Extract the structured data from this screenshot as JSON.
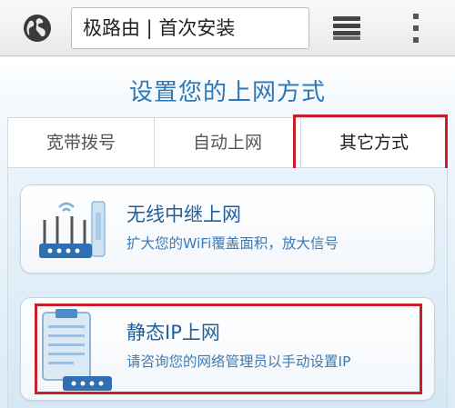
{
  "browser": {
    "address": "极路由 | 首次安装",
    "icons": {
      "globe": "globe-icon",
      "tabs": "tabs-icon",
      "menu": "more-vertical-icon"
    }
  },
  "page": {
    "title": "设置您的上网方式",
    "tabs": [
      {
        "label": "宽带拨号"
      },
      {
        "label": "自动上网"
      },
      {
        "label": "其它方式",
        "selected": true
      }
    ],
    "options": [
      {
        "title": "无线中继上网",
        "desc": "扩大您的WiFi覆盖面积，放大信号",
        "icon": "wireless-repeater-icon"
      },
      {
        "title": "静态IP上网",
        "desc": "请咨询您的网络管理员以手动设置IP",
        "icon": "static-ip-router-icon",
        "highlighted": true
      }
    ]
  },
  "colors": {
    "accent": "#2c77b6",
    "highlight": "#c8202a"
  }
}
